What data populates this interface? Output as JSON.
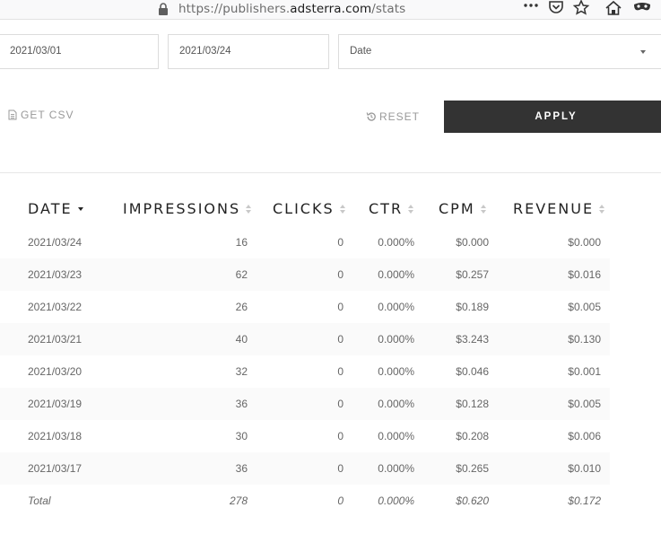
{
  "browser": {
    "url_prefix": "https://publishers.",
    "url_host": "adsterra.com",
    "url_path": "/stats"
  },
  "filters": {
    "start_date": "2021/03/01",
    "end_date": "2021/03/24",
    "group_by": "Date"
  },
  "actions": {
    "csv_label": "GET CSV",
    "reset_label": "RESET",
    "apply_label": "APPLY"
  },
  "table": {
    "columns": [
      "DATE",
      "IMPRESSIONS",
      "CLICKS",
      "CTR",
      "CPM",
      "REVENUE"
    ],
    "rows": [
      {
        "date": "2021/03/24",
        "impressions": "16",
        "clicks": "0",
        "ctr": "0.000%",
        "cpm": "$0.000",
        "revenue": "$0.000"
      },
      {
        "date": "2021/03/23",
        "impressions": "62",
        "clicks": "0",
        "ctr": "0.000%",
        "cpm": "$0.257",
        "revenue": "$0.016"
      },
      {
        "date": "2021/03/22",
        "impressions": "26",
        "clicks": "0",
        "ctr": "0.000%",
        "cpm": "$0.189",
        "revenue": "$0.005"
      },
      {
        "date": "2021/03/21",
        "impressions": "40",
        "clicks": "0",
        "ctr": "0.000%",
        "cpm": "$3.243",
        "revenue": "$0.130"
      },
      {
        "date": "2021/03/20",
        "impressions": "32",
        "clicks": "0",
        "ctr": "0.000%",
        "cpm": "$0.046",
        "revenue": "$0.001"
      },
      {
        "date": "2021/03/19",
        "impressions": "36",
        "clicks": "0",
        "ctr": "0.000%",
        "cpm": "$0.128",
        "revenue": "$0.005"
      },
      {
        "date": "2021/03/18",
        "impressions": "30",
        "clicks": "0",
        "ctr": "0.000%",
        "cpm": "$0.208",
        "revenue": "$0.006"
      },
      {
        "date": "2021/03/17",
        "impressions": "36",
        "clicks": "0",
        "ctr": "0.000%",
        "cpm": "$0.265",
        "revenue": "$0.010"
      }
    ],
    "total": {
      "label": "Total",
      "impressions": "278",
      "clicks": "0",
      "ctr": "0.000%",
      "cpm": "$0.620",
      "revenue": "$0.172"
    }
  }
}
